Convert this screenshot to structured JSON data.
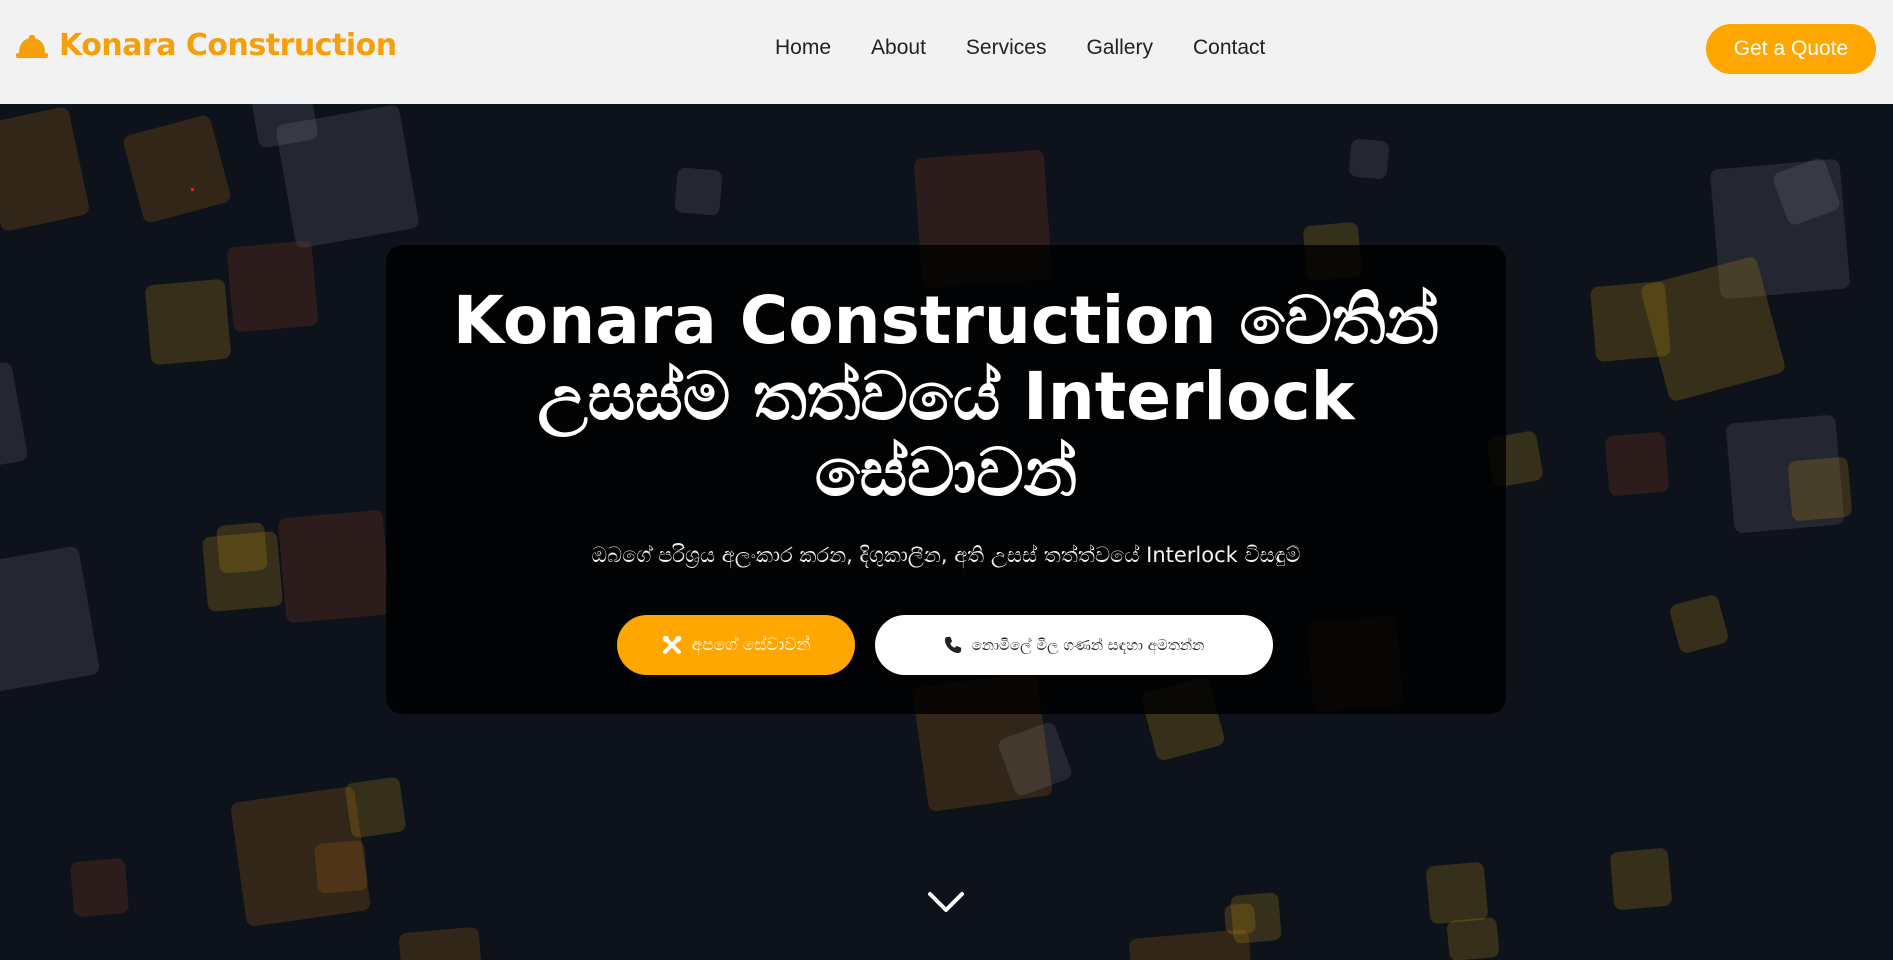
{
  "navbar": {
    "brand": "Konara Construction",
    "brand_icon": "hard-hat-icon",
    "links": [
      "Home",
      "About",
      "Services",
      "Gallery",
      "Contact"
    ],
    "quote_button": "Get a Quote"
  },
  "hero": {
    "title": "Konara Construction වෙතින් උසස්ම තත්වයේ Interlock සේවාවන්",
    "subtitle": "ඔබගේ පරිශ්‍රය අලංකාර කරන, දිගුකාලීන, අති උසස් තත්ත්වයේ Interlock විසඳුම්",
    "services_button": "අපගේ සේවාවන්",
    "services_icon": "tools-icon",
    "call_button": "නොමිලේ මිල ගණන් සඳහා අමතන්න",
    "call_icon": "phone-icon",
    "scroll_icon": "chevron-down-icon"
  },
  "colors": {
    "accent": "#ffa600",
    "navbar_bg": "#f2f2f2",
    "hero_bg": "#0e121b"
  }
}
